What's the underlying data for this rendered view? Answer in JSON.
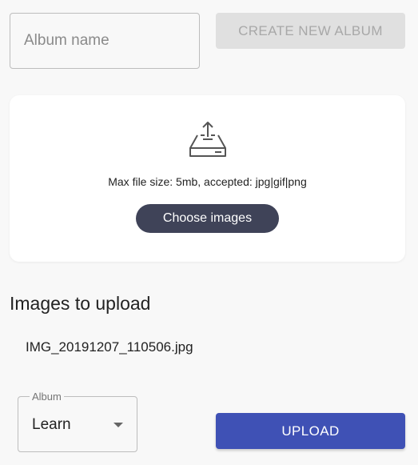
{
  "album_form": {
    "name_placeholder": "Album name",
    "name_value": "",
    "create_button_label": "CREATE NEW ALBUM",
    "create_button_enabled": false
  },
  "dropzone": {
    "icon": "upload-tray-icon",
    "hint": "Max file size: 5mb, accepted: jpg|gif|png",
    "choose_button_label": "Choose images"
  },
  "upload_section": {
    "title": "Images to upload",
    "files": [
      "IMG_20191207_110506.jpg"
    ],
    "album_select": {
      "label": "Album",
      "selected": "Learn"
    },
    "upload_button_label": "UPLOAD"
  },
  "colors": {
    "background": "#f8f8f8",
    "primary": "#3f51b5",
    "choose_button": "#3f4358",
    "disabled_button_bg": "#e0e0e0",
    "disabled_button_text": "#a8a8a8"
  }
}
